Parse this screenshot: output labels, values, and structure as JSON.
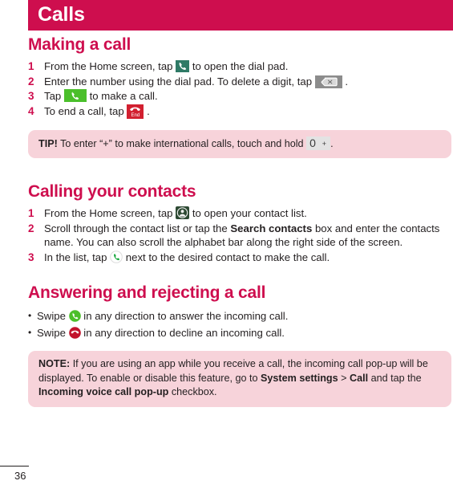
{
  "header": {
    "title": "Calls",
    "band_color": "#ce0e4e"
  },
  "sections": {
    "making_a_call": {
      "title": "Making a call",
      "steps": [
        {
          "num": "1",
          "text_before": "From the Home screen, tap",
          "icon": "dialpad-icon",
          "text_after": "to open the dial pad."
        },
        {
          "num": "2",
          "text_before": "Enter the number using the dial pad. To delete a digit, tap",
          "icon": "delete-backspace-icon",
          "text_after": "."
        },
        {
          "num": "3",
          "text_before": "Tap",
          "icon": "make-call-icon",
          "text_after": "to make a call."
        },
        {
          "num": "4",
          "text_before": "To end a call, tap",
          "icon": "end-call-icon",
          "text_after": "."
        }
      ]
    },
    "tip": {
      "label": "TIP!",
      "text_before": "To enter “+” to make international calls, touch and hold",
      "icon": "zero-plus-key-icon",
      "key_digit": "0",
      "key_plus": "+",
      "text_after": "."
    },
    "calling_your_contacts": {
      "title": "Calling your contacts",
      "steps": [
        {
          "num": "1",
          "text_before": "From the Home screen, tap",
          "icon": "contacts-icon",
          "text_after": "to open your contact list."
        },
        {
          "num": "2",
          "text_part1": "Scroll through the contact list or tap the",
          "bold1": "Search contacts",
          "text_part2": "box and enter the contacts name. You can also scroll the alphabet bar along the right side of the screen."
        },
        {
          "num": "3",
          "text_before": "In the list, tap",
          "icon": "phone-circle-icon",
          "text_after": "next to the desired contact to make the call."
        }
      ]
    },
    "answering_and_rejecting": {
      "title": "Answering and rejecting a call",
      "bullets": [
        {
          "text_before": "Swipe",
          "icon": "answer-call-icon",
          "text_after": "in any direction to answer the incoming call."
        },
        {
          "text_before": "Swipe",
          "icon": "decline-call-icon",
          "text_after": "in any direction to decline an incoming call."
        }
      ]
    },
    "note": {
      "label": "NOTE:",
      "text_part1": "If you are using an app while you receive a call, the incoming call pop-up will be displayed. To enable or disable this feature, go to",
      "bold1": "System settings",
      "separator": ">",
      "bold2": "Call",
      "text_part2": "and tap the",
      "bold3": "Incoming voice call pop-up",
      "text_part3": "checkbox."
    }
  },
  "footer": {
    "page_number": "36"
  },
  "colors": {
    "accent": "#ce0e4e",
    "callout_bg": "#f7d3da",
    "green": "#4bbf2b",
    "red": "#d22030",
    "teal": "#2f7a66"
  }
}
